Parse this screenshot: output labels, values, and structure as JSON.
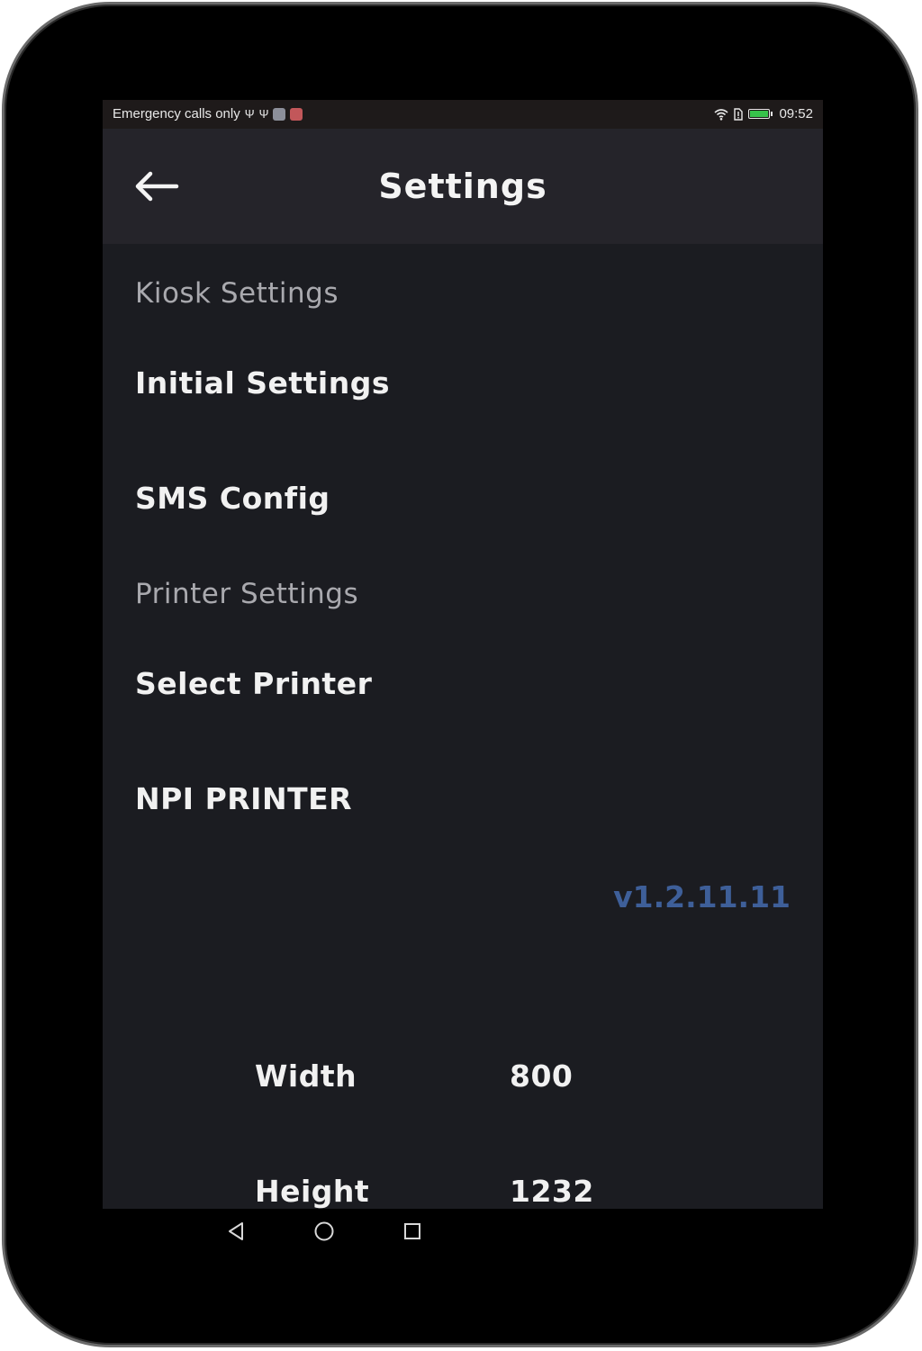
{
  "status_bar": {
    "carrier_text": "Emergency calls only",
    "time": "09:52",
    "icons_left": [
      "usb-icon",
      "usb-icon",
      "app-notification-icon",
      "app-notification-icon"
    ],
    "icons_right": [
      "wifi-icon",
      "sim-icon",
      "battery-icon"
    ],
    "battery_color": "#37c24a"
  },
  "app_bar": {
    "title": "Settings",
    "back_icon": "arrow-left-icon"
  },
  "sections": [
    {
      "header": "Kiosk Settings",
      "items": [
        "Initial Settings",
        "SMS Config"
      ]
    },
    {
      "header": "Printer Settings",
      "items": [
        "Select Printer",
        "NPI PRINTER"
      ]
    }
  ],
  "version": "v1.2.11.11",
  "display": {
    "width_label": "Width",
    "width_value": "800",
    "height_label": "Height",
    "height_value": "1232"
  },
  "nav_bar": {
    "buttons": [
      "back-triangle-icon",
      "home-circle-icon",
      "recents-square-icon"
    ]
  },
  "colors": {
    "background": "#1b1c21",
    "app_bar": "#25242a",
    "section_header": "#a9a9ae",
    "item_text": "#f1f1f1",
    "version_accent": "#3e5f99"
  }
}
